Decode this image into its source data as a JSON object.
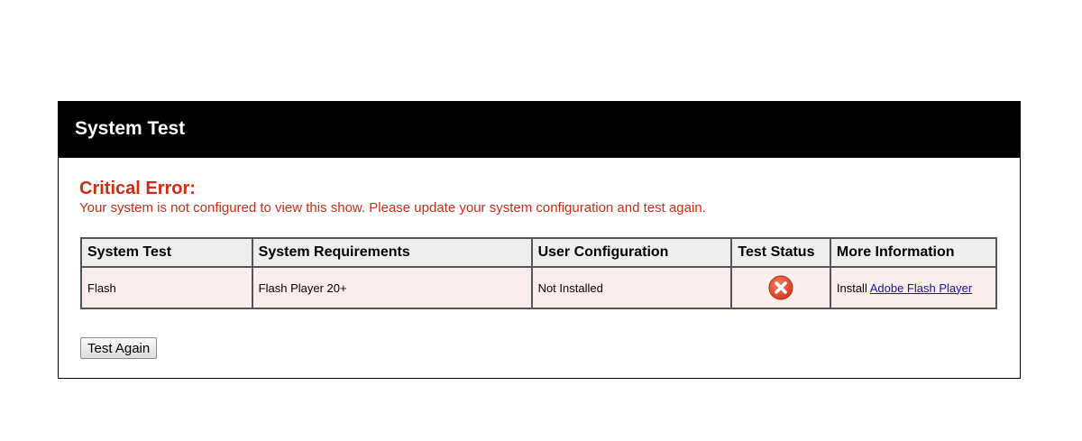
{
  "panel": {
    "title": "System Test"
  },
  "error": {
    "title": "Critical Error:",
    "message": "Your system is not configured to view this show. Please update your system configuration and test again."
  },
  "table": {
    "headers": [
      "System Test",
      "System Requirements",
      "User Configuration",
      "Test Status",
      "More Information"
    ],
    "rows": [
      {
        "test": "Flash",
        "requirement": "Flash Player 20+",
        "user_config": "Not Installed",
        "status_icon": "error-x-icon",
        "more_info_prefix": "Install ",
        "more_info_link": "Adobe Flash Player"
      }
    ]
  },
  "actions": {
    "test_again": "Test Again"
  },
  "colors": {
    "error": "#cc2d14",
    "header_bg": "#000000",
    "row_bg": "#fdeeee",
    "icon_red": "#e04a2f",
    "link": "#1a0dab"
  }
}
